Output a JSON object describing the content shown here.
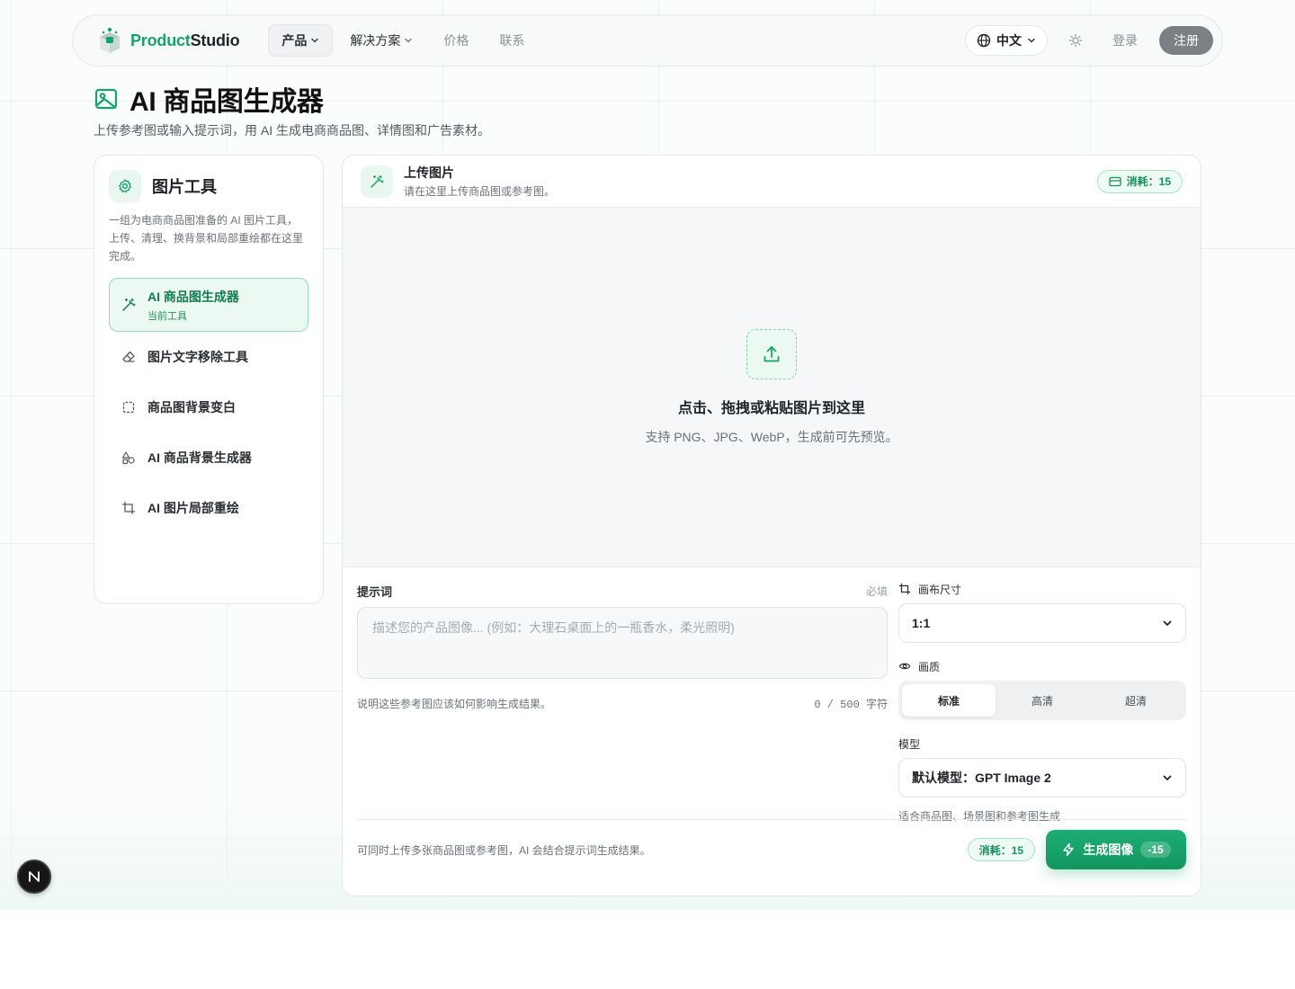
{
  "brand": {
    "name_part1": "Product",
    "name_part2": "Studio"
  },
  "nav": {
    "items": [
      {
        "label": "产品",
        "has_dropdown": true,
        "active": true
      },
      {
        "label": "解决方案",
        "has_dropdown": true,
        "active": false
      },
      {
        "label": "价格",
        "has_dropdown": false,
        "active": false
      },
      {
        "label": "联系",
        "has_dropdown": false,
        "active": false
      }
    ]
  },
  "header": {
    "language": "中文",
    "login": "登录",
    "signup": "注册"
  },
  "page": {
    "title": "AI 商品图生成器",
    "subtitle": "上传参考图或输入提示词，用 AI 生成电商商品图、详情图和广告素材。"
  },
  "sidebar": {
    "title": "图片工具",
    "description": "一组为电商商品图准备的 AI 图片工具，上传、清理、换背景和局部重绘都在这里完成。",
    "items": [
      {
        "label": "AI 商品图生成器",
        "sub": "当前工具",
        "icon": "magic-wand-icon"
      },
      {
        "label": "图片文字移除工具",
        "icon": "eraser-icon"
      },
      {
        "label": "商品图背景变白",
        "icon": "square-dashed-icon"
      },
      {
        "label": "AI 商品背景生成器",
        "icon": "shapes-icon"
      },
      {
        "label": "AI 图片局部重绘",
        "icon": "crop-icon"
      }
    ]
  },
  "upload": {
    "title": "上传图片",
    "subtitle": "请在这里上传商品图或参考图。",
    "cost_label": "消耗：15",
    "drop_title": "点击、拖拽或粘贴图片到这里",
    "drop_hint": "支持 PNG、JPG、WebP，生成前可先预览。"
  },
  "form": {
    "prompt_label": "提示词",
    "prompt_required": "必填",
    "prompt_placeholder": "描述您的产品图像... (例如：大理石桌面上的一瓶香水，柔光照明)",
    "prompt_value": "",
    "prompt_hint": "说明这些参考图应该如何影响生成结果。",
    "char_count": "0 / 500 字符",
    "canvas_label": "画布尺寸",
    "canvas_value": "1:1",
    "quality_label": "画质",
    "quality_options": [
      "标准",
      "高清",
      "超清"
    ],
    "quality_selected": "标准",
    "model_label": "模型",
    "model_value": "默认模型：GPT Image 2",
    "model_note": "适合商品图、场景图和参考图生成",
    "footer_note": "可同时上传多张商品图或参考图，AI 会结合提示词生成结果。",
    "footer_cost": "消耗：15",
    "generate_label": "生成图像",
    "generate_cost": "-15"
  },
  "fab": {
    "label": "N"
  },
  "colors": {
    "accent": "#16a36b",
    "accent_light": "#ecf9f3",
    "signup_bg": "#7c7f83"
  }
}
